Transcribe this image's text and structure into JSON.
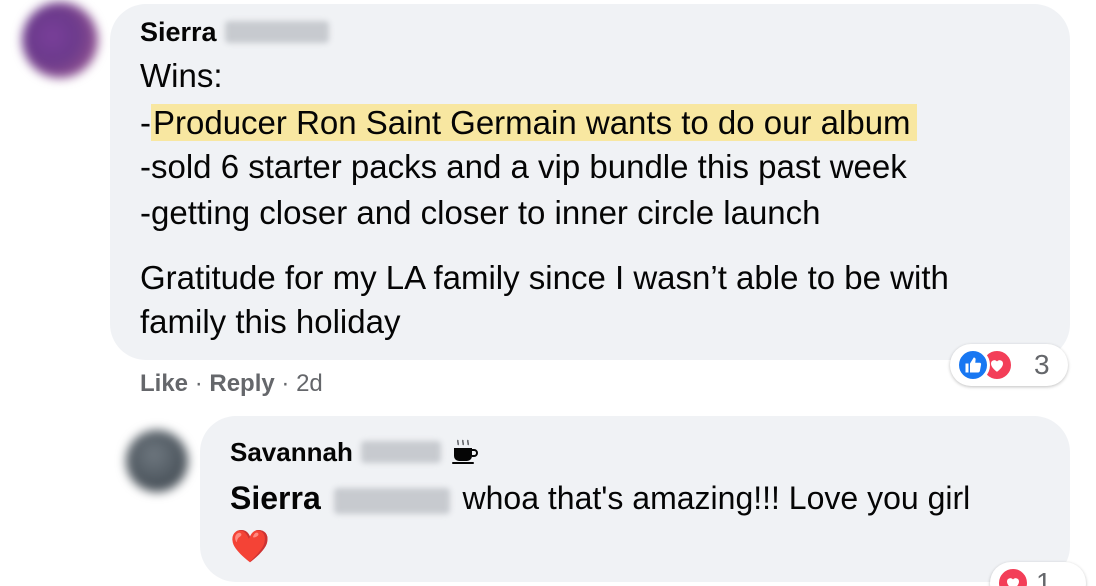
{
  "comment": {
    "author_first": "Sierra",
    "lines": [
      "Wins:",
      "-",
      "Producer Ron Saint Germain wants to do our album",
      "-sold 6 starter packs and a vip bundle this past week",
      "-getting closer and closer to inner circle launch",
      "Gratitude for my LA family since I wasn’t able to be with",
      "family this holiday"
    ],
    "reaction_count": "3",
    "actions": {
      "like": "Like",
      "sep": "·",
      "reply": "Reply",
      "time": "2d"
    }
  },
  "reply": {
    "author_first": "Savannah",
    "mention_first": "Sierra",
    "text": "whoa that's amazing!!! Love you girl",
    "emoji": "❤️",
    "reaction_count": "1"
  },
  "colors": {
    "bubble": "#f0f2f5",
    "highlight": "#f8e7a1",
    "like_blue": "#1877f2",
    "love_red": "#f33e58",
    "meta_gray": "#65676b"
  },
  "icons": {
    "like": "thumbs-up-icon",
    "love": "heart-icon",
    "badge": "coffee-cup-icon"
  }
}
